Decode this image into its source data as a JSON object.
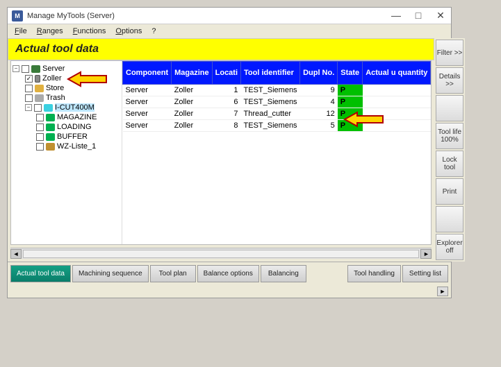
{
  "window": {
    "title": "Manage MyTools  (Server)"
  },
  "menu": {
    "file": "File",
    "ranges": "Ranges",
    "functions": "Functions",
    "options": "Options",
    "help": "?"
  },
  "banner": {
    "title": "Actual tool data"
  },
  "tree": {
    "server": "Server",
    "zoller": "Zoller",
    "store": "Store",
    "trash": "Trash",
    "machine": "I-CUT400M",
    "magazine": "MAGAZINE",
    "loading": "LOADING",
    "buffer": "BUFFER",
    "wzliste": "WZ-Liste_1"
  },
  "grid": {
    "headers": {
      "component": "Component",
      "magazine": "Magazine",
      "location": "Locati",
      "tool_id": "Tool identifier",
      "dupl": "Dupl No.",
      "state": "State",
      "actual": "Actual u quantity"
    },
    "rows": [
      {
        "component": "Server",
        "magazine": "Zoller",
        "location": 1,
        "tool_id": "TEST_Siemens",
        "dupl": 9,
        "state": "P"
      },
      {
        "component": "Server",
        "magazine": "Zoller",
        "location": 6,
        "tool_id": "TEST_Siemens",
        "dupl": 4,
        "state": "P"
      },
      {
        "component": "Server",
        "magazine": "Zoller",
        "location": 7,
        "tool_id": "Thread_cutter",
        "dupl": 12,
        "state": "P"
      },
      {
        "component": "Server",
        "magazine": "Zoller",
        "location": 8,
        "tool_id": "TEST_Siemens",
        "dupl": 5,
        "state": "P"
      }
    ]
  },
  "side": {
    "filter": "Filter >>",
    "details": "Details >>",
    "tool_life": "Tool life 100%",
    "lock": "Lock tool",
    "print": "Print",
    "explorer": "Explorer off"
  },
  "tabs": {
    "actual": "Actual tool data",
    "machining": "Machining sequence",
    "tool_plan": "Tool plan",
    "balance_opts": "Balance options",
    "balancing": "Balancing",
    "tool_handling": "Tool handling",
    "setting_list": "Setting list"
  }
}
